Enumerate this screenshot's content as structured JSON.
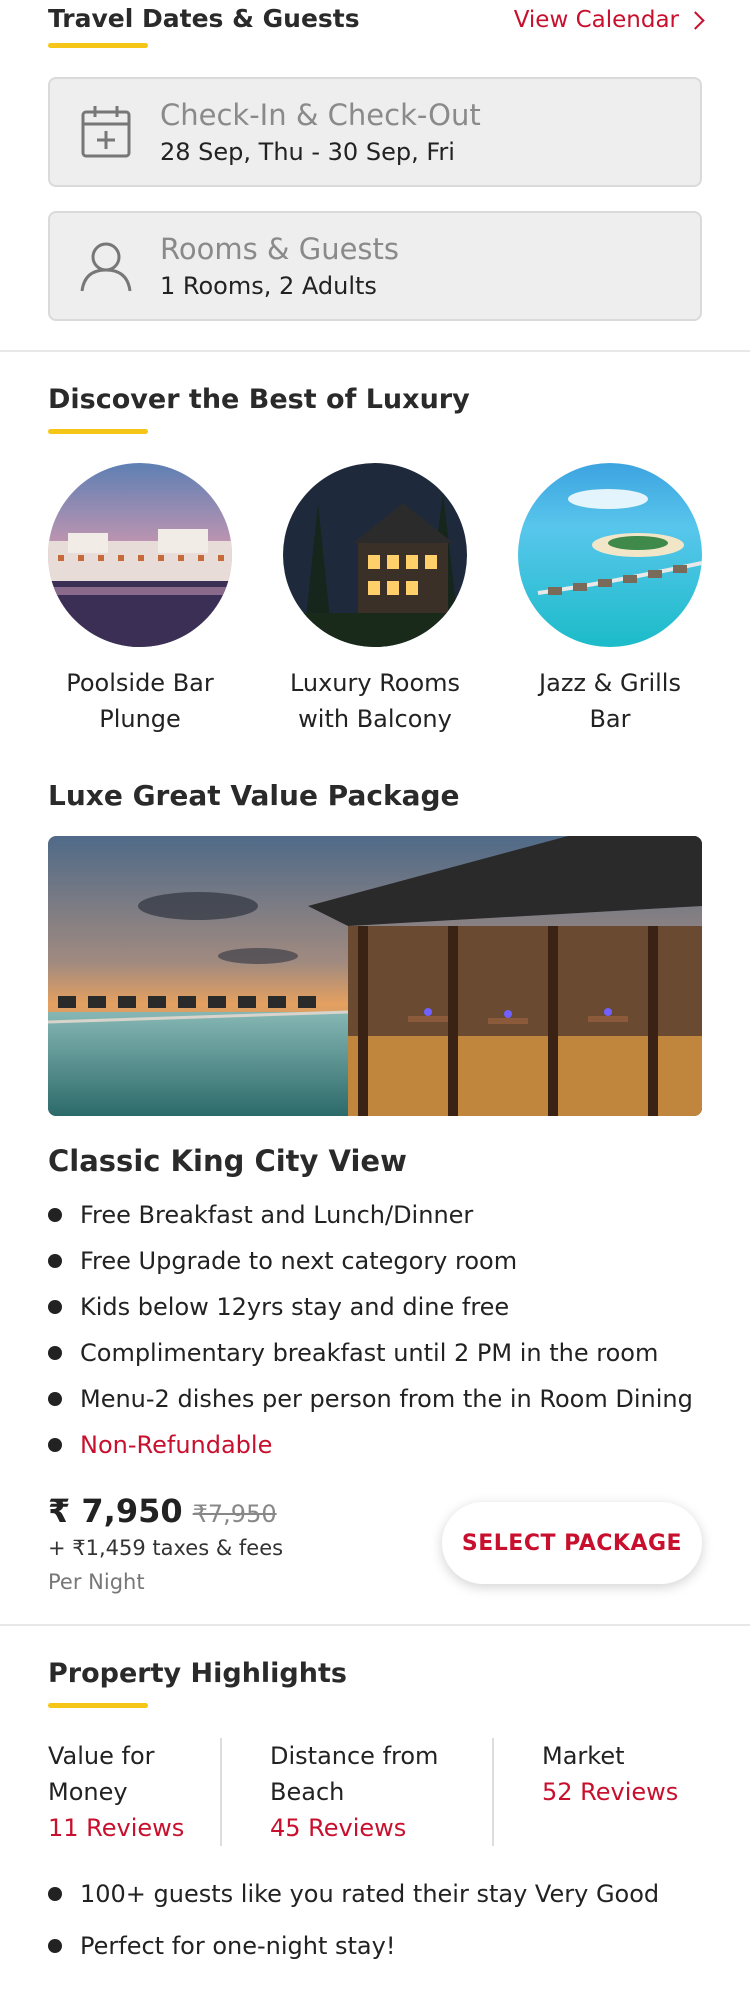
{
  "travel": {
    "title": "Travel Dates & Guests",
    "view_calendar": "View Calendar",
    "checkin_label": "Check-In & Check-Out",
    "checkin_value": "28 Sep, Thu - 30 Sep, Fri",
    "rooms_label": "Rooms & Guests",
    "rooms_value": "1 Rooms, 2 Adults"
  },
  "discover": {
    "title": "Discover the Best of Luxury",
    "items": [
      {
        "line1": "Poolside Bar",
        "line2": "Plunge"
      },
      {
        "line1": "Luxury Rooms",
        "line2": "with Balcony"
      },
      {
        "line1": "Jazz & Grills",
        "line2": "Bar"
      }
    ]
  },
  "package": {
    "title": "Luxe Great Value Package",
    "room_title": "Classic King City View",
    "features": [
      "Free Breakfast and Lunch/Dinner",
      "Free Upgrade to next category room",
      "Kids below 12yrs stay and dine free",
      "Complimentary breakfast until 2 PM in the room",
      "Menu-2 dishes per person from the in Room Dining",
      "Non-Refundable"
    ],
    "price": "₹ 7,950",
    "old_price": "₹7,950",
    "taxes": "+ ₹1,459 taxes & fees",
    "per_night": "Per Night",
    "select_label": "SELECT PACKAGE"
  },
  "highlights": {
    "title": "Property Highlights",
    "columns": [
      {
        "line1": "Value for",
        "line2": "Money",
        "reviews": "11 Reviews"
      },
      {
        "line1": "Distance from",
        "line2": "Beach",
        "reviews": "45 Reviews"
      },
      {
        "line1": "Market",
        "line2": "",
        "reviews": "52 Reviews"
      }
    ],
    "bullets": [
      "100+ guests like you rated their stay Very Good",
      "Perfect for one-night stay!"
    ]
  },
  "colors": {
    "accent_red": "#c8102e",
    "underline_yellow": "#f5c518",
    "field_bg": "#eeeeee"
  },
  "icons": [
    "calendar-plus-icon",
    "user-icon",
    "chevron-right-icon"
  ]
}
